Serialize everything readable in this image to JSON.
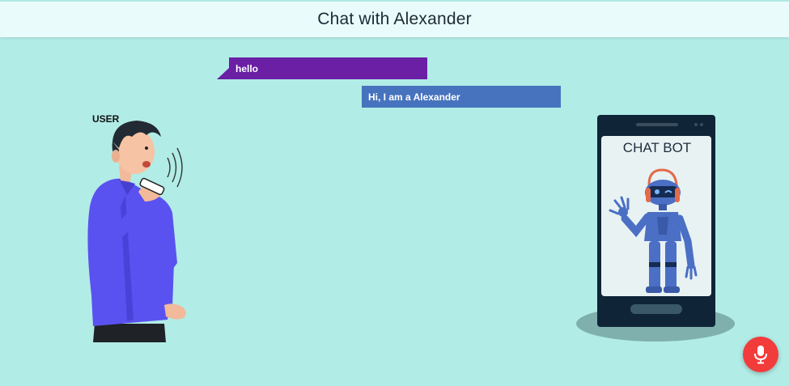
{
  "header": {
    "title": "Chat with Alexander"
  },
  "messages": [
    {
      "sender": "user",
      "text": "hello"
    },
    {
      "sender": "bot",
      "text": "Hi, I am a Alexander"
    }
  ],
  "user_figure": {
    "label": "USER"
  },
  "bot_figure": {
    "label": "CHAT BOT"
  },
  "mic_button": {
    "icon": "microphone-icon",
    "color": "#f23b3b"
  },
  "colors": {
    "background": "#b2ece6",
    "header_background": "#e9fcfb",
    "user_bubble": "#6a1fa4",
    "bot_bubble": "#4773be"
  }
}
